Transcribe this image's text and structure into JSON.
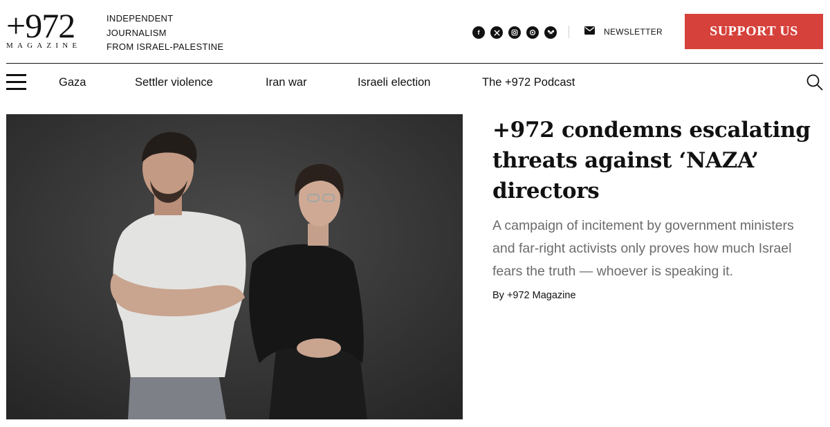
{
  "brand": {
    "logo_main": "+972",
    "logo_sub": "MAGAZINE",
    "tagline": [
      "INDEPENDENT",
      "JOURNALISM",
      "FROM ISRAEL-PALESTINE"
    ]
  },
  "header": {
    "socials": [
      {
        "name": "facebook-icon",
        "glyph": "f"
      },
      {
        "name": "x-icon",
        "glyph": "𝕏"
      },
      {
        "name": "instagram-icon",
        "glyph": "◘"
      },
      {
        "name": "threads-icon",
        "glyph": "@"
      },
      {
        "name": "bluesky-icon",
        "glyph": "🦋"
      }
    ],
    "newsletter_label": "NEWSLETTER",
    "support_label": "SUPPORT US",
    "support_color": "#d6413b"
  },
  "nav": {
    "items": [
      "Gaza",
      "Settler violence",
      "Iran war",
      "Israeli election",
      "The +972 Podcast"
    ]
  },
  "hero": {
    "headline": "+972 condemns escalating threats against ‘NAZA’ directors",
    "dek": "A campaign of incitement by government ministers and far-right activists only proves how much Israel fears the truth — whoever is speaking it.",
    "byline_prefix": "By ",
    "byline_author": "+972 Magazine"
  }
}
